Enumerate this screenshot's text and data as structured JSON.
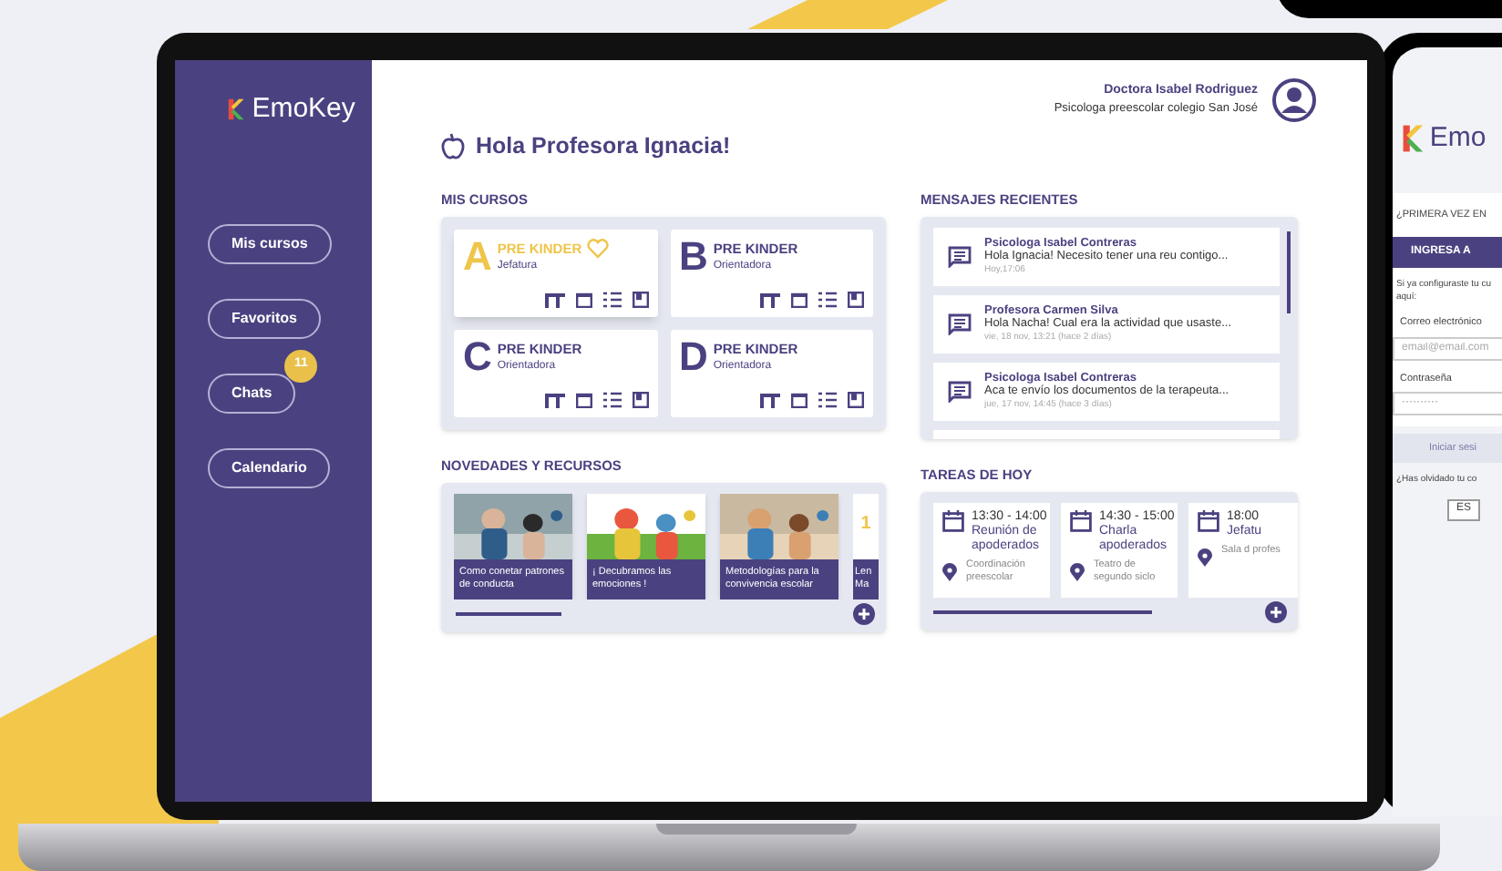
{
  "sidebar": {
    "logo": "EmoKey",
    "items": [
      {
        "label": "Mis cursos"
      },
      {
        "label": "Favoritos"
      },
      {
        "label": "Chats",
        "badge": "11"
      },
      {
        "label": "Calendario"
      }
    ]
  },
  "user": {
    "name": "Doctora Isabel Rodriguez",
    "role": "Psicologa preescolar colegio San José"
  },
  "greeting": "Hola Profesora Ignacia!",
  "courses": {
    "title": "MIS CURSOS",
    "items": [
      {
        "letter": "A",
        "name": "PRE KINDER",
        "role": "Jefatura",
        "favorite": true
      },
      {
        "letter": "B",
        "name": "PRE KINDER",
        "role": "Orientadora",
        "favorite": false
      },
      {
        "letter": "C",
        "name": "PRE KINDER",
        "role": "Orientadora",
        "favorite": false
      },
      {
        "letter": "D",
        "name": "PRE KINDER",
        "role": "Orientadora",
        "favorite": false
      }
    ]
  },
  "messages": {
    "title": "MENSAJES RECIENTES",
    "items": [
      {
        "sender": "Psicologa Isabel Contreras",
        "text": "Hola Ignacia! Necesito tener una reu contigo...",
        "time": "Hoy,17:06"
      },
      {
        "sender": "Profesora Carmen Silva",
        "text": "Hola Nacha! Cual era la actividad que usaste...",
        "time": "vie, 18 nov, 13:21 (hace 2 días)"
      },
      {
        "sender": "Psicologa Isabel Contreras",
        "text": "Aca te envío los documentos de la terapeuta...",
        "time": "jue, 17 nov, 14:45 (hace 3 días)"
      }
    ]
  },
  "news": {
    "title": "NOVEDADES Y RECURSOS",
    "items": [
      {
        "title": "Como conetar patrones de conducta",
        "kind": "picture"
      },
      {
        "title": "¡ Decubramos las emociones !",
        "kind": "picture"
      },
      {
        "title": "Metodologías para la convivencia escolar",
        "kind": "picture"
      },
      {
        "title": "Len Ma",
        "kind": "partial",
        "mark": "1"
      }
    ]
  },
  "tasks": {
    "title": "TAREAS DE HOY",
    "items": [
      {
        "time": "13:30 - 14:00",
        "title": "Reunión de apoderados",
        "place": "Coordinación preescolar"
      },
      {
        "time": "14:30 - 15:00",
        "title": "Charla apoderados",
        "place": "Teatro de segundo siclo"
      },
      {
        "time": "18:00",
        "title": "Jefatu",
        "place": "Sala d profes"
      }
    ]
  },
  "phone": {
    "logo": "Emo",
    "heading": "¿PRIMERA VEZ EN",
    "tab": "INGRESA A",
    "intro": "Si ya configuraste tu cu aquí:",
    "email_label": "Correo electrónico",
    "email": {
      "placeholder": "email@email.com"
    },
    "password_label": "Contraseña",
    "password": "··········",
    "login": "Iniciar sesi",
    "forgot": "¿Has olvidado tu co",
    "language": "ES"
  }
}
